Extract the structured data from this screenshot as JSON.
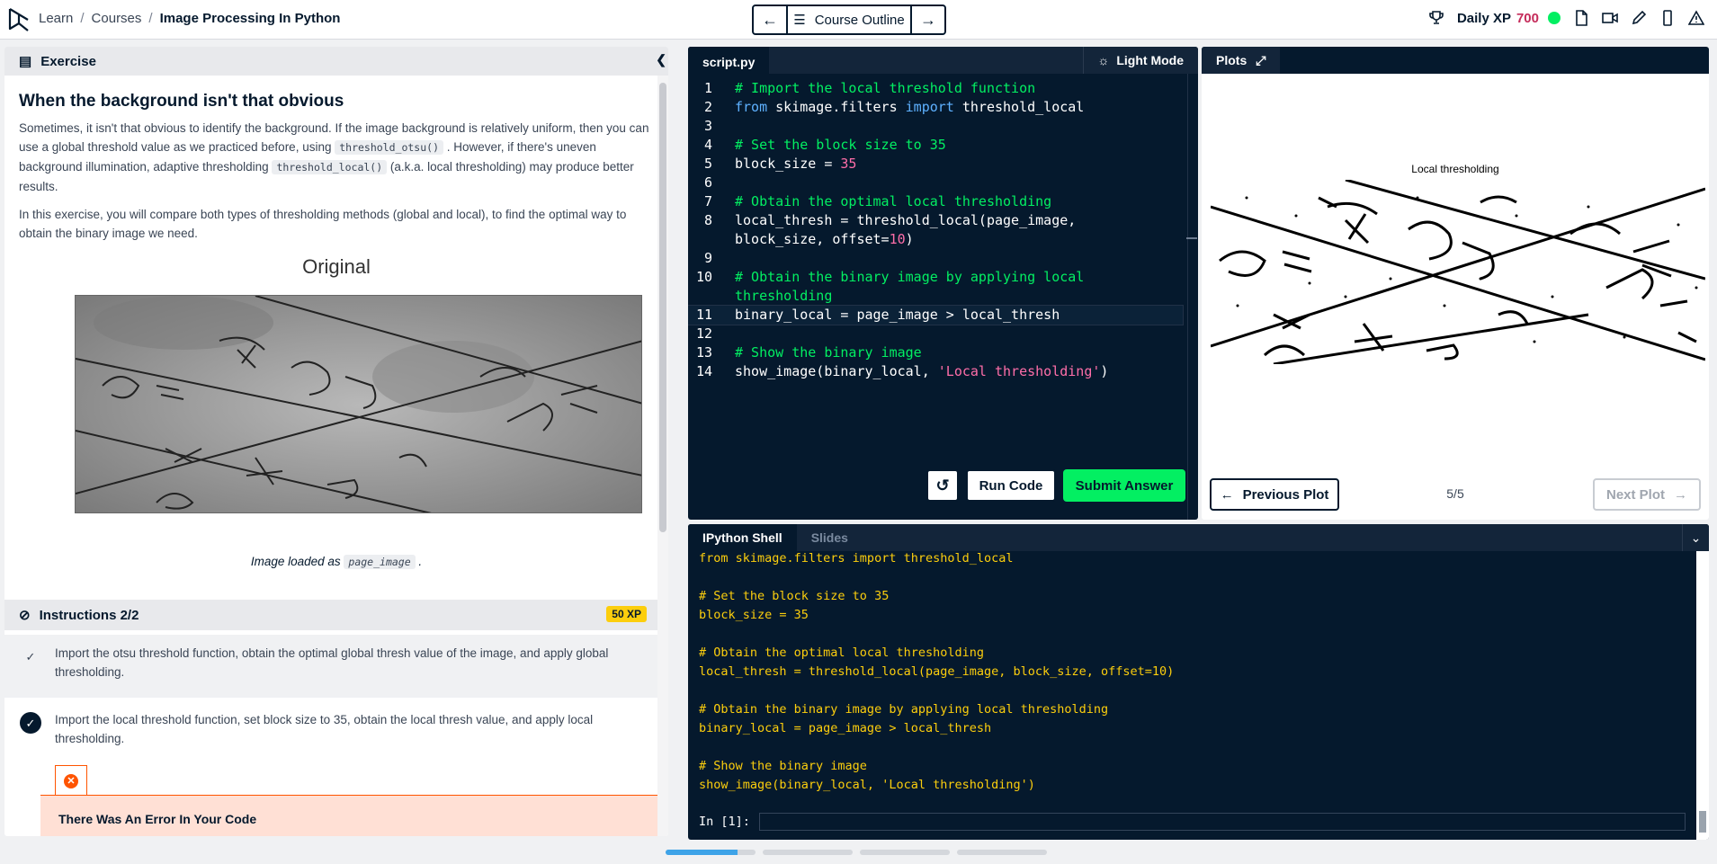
{
  "breadcrumb": {
    "learn": "Learn",
    "courses": "Courses",
    "sep": "/",
    "current": "Image Processing In Python"
  },
  "nav": {
    "outline_label": "Course Outline",
    "prev_icon": "arrow-left-icon",
    "next_icon": "arrow-right-icon"
  },
  "topright": {
    "daily_xp_label": "Daily XP",
    "daily_xp_value": "700"
  },
  "exercise": {
    "header": "Exercise",
    "title": "When the background isn't that obvious",
    "p1_a": "Sometimes, it isn't that obvious to identify the background. If the image background is relatively uniform, then you can use a global threshold value as we practiced before, using ",
    "p1_code1": "threshold_otsu()",
    "p1_b": " . However, if there's uneven background illumination, adaptive thresholding ",
    "p1_code2": "threshold_local()",
    "p1_c": " (a.k.a. local thresholding) may produce better results.",
    "p2": "In this exercise, you will compare both types of thresholding methods (global and local), to find the optimal way to obtain the binary image we need.",
    "image_title": "Original",
    "caption_a": "Image loaded as ",
    "caption_code": "page_image",
    "caption_b": " ."
  },
  "instructions": {
    "header": "Instructions 2/2",
    "xp": "50 XP",
    "step1": "Import the otsu threshold function, obtain the optimal global thresh value of the image, and apply global thresholding.",
    "step2": "Import the local threshold function, set block size to 35, obtain the local thresh value, and apply local thresholding.",
    "error": "There Was An Error In Your Code"
  },
  "editor": {
    "tab": "script.py",
    "light_mode": "Light Mode",
    "run": "Run Code",
    "submit": "Submit Answer",
    "lines": {
      "l1": "# Import the local threshold function",
      "l2_kw1": "from",
      "l2_mod": " skimage.filters ",
      "l2_kw2": "import",
      "l2_fn": " threshold_local",
      "l4": "# Set the block size to 35",
      "l5_a": "block_size = ",
      "l5_num": "35",
      "l7": "# Obtain the optimal local thresholding",
      "l8_a": "local_thresh = threshold_local(page_image,",
      "l8_b": "block_size, offset=",
      "l8_num": "10",
      "l8_c": ")",
      "l10_a": "# Obtain the binary image by applying local",
      "l10_b": "thresholding",
      "l11": "binary_local = page_image > local_thresh",
      "l13": "# Show the binary image",
      "l14_a": "show_image(binary_local, ",
      "l14_str": "'Local thresholding'",
      "l14_b": ")"
    },
    "numbers": [
      "1",
      "2",
      "3",
      "4",
      "5",
      "6",
      "7",
      "8",
      "",
      "9",
      "10",
      "",
      "11",
      "12",
      "13",
      "14"
    ]
  },
  "plots": {
    "tab": "Plots",
    "title": "Local thresholding",
    "prev": "Previous Plot",
    "counter": "5/5",
    "next": "Next Plot"
  },
  "shell": {
    "tab_shell": "IPython Shell",
    "tab_slides": "Slides",
    "lines": [
      "from skimage.filters import threshold_local",
      "",
      "# Set the block size to 35",
      "block_size = 35",
      "",
      "# Obtain the optimal local thresholding",
      "local_thresh = threshold_local(page_image, block_size, offset=10)",
      "",
      "# Obtain the binary image by applying local thresholding",
      "binary_local = page_image > local_thresh",
      "",
      "# Show the binary image",
      "show_image(binary_local, 'Local thresholding')"
    ],
    "prompt": "In [1]:"
  },
  "progress": {
    "segments": [
      0.8,
      0,
      0,
      0
    ]
  }
}
